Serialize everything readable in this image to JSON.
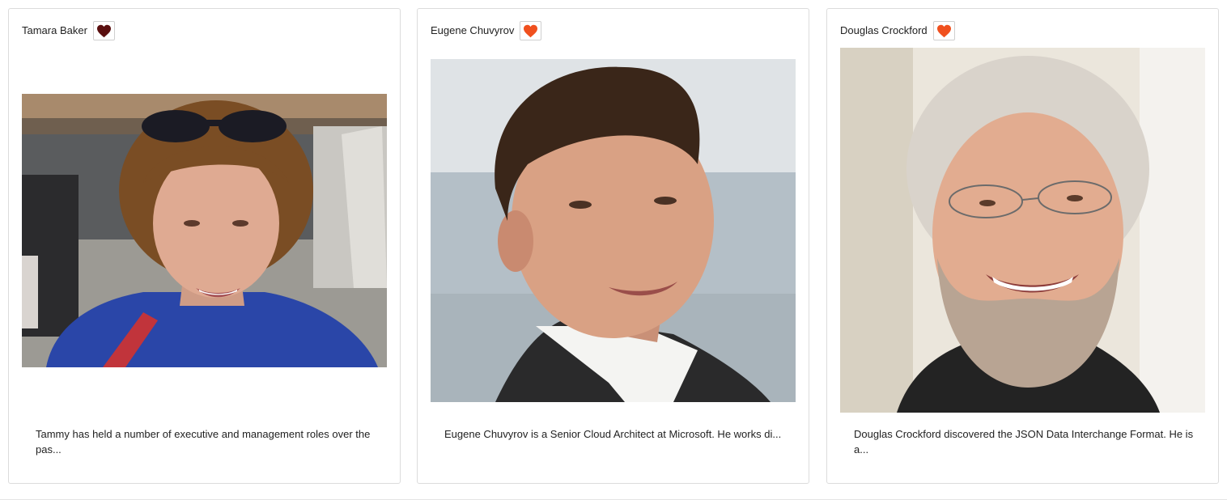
{
  "speakers": [
    {
      "name": "Tamara Baker",
      "favorite_icon": "heart-icon",
      "favorite_color": "#5a0f0f",
      "photo_alt": "Tamara Baker",
      "bio": "Tammy has held a number of executive and management roles over the pas..."
    },
    {
      "name": "Eugene Chuvyrov",
      "favorite_icon": "heart-icon",
      "favorite_color": "#f0501e",
      "photo_alt": "Eugene Chuvyrov",
      "bio": "Eugene Chuvyrov is a Senior Cloud Architect at Microsoft. He works di..."
    },
    {
      "name": "Douglas Crockford",
      "favorite_icon": "heart-icon",
      "favorite_color": "#f0501e",
      "photo_alt": "Douglas Crockford",
      "bio": "Douglas Crockford discovered the JSON Data Interchange Format. He is a..."
    }
  ]
}
